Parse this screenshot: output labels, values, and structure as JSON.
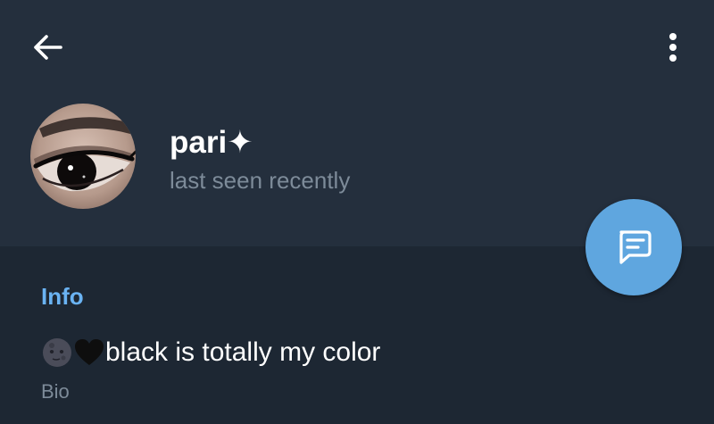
{
  "header": {
    "back_icon": "arrow-left-icon",
    "menu_icon": "more-vertical-icon",
    "bg_color": "#242f3d"
  },
  "profile": {
    "name": "pari✦",
    "status": "last seen recently",
    "avatar": "eye-photo-avatar"
  },
  "fab": {
    "icon": "message-icon",
    "color": "#5fa6df"
  },
  "info": {
    "section_title": "Info",
    "bio_emojis": [
      "new-moon-face-emoji",
      "black-heart-emoji"
    ],
    "bio_text": "black is totally my color",
    "bio_label": "Bio"
  },
  "colors": {
    "background": "#1d2733",
    "accent": "#6ab3f3",
    "secondary_text": "#7d8b99"
  }
}
